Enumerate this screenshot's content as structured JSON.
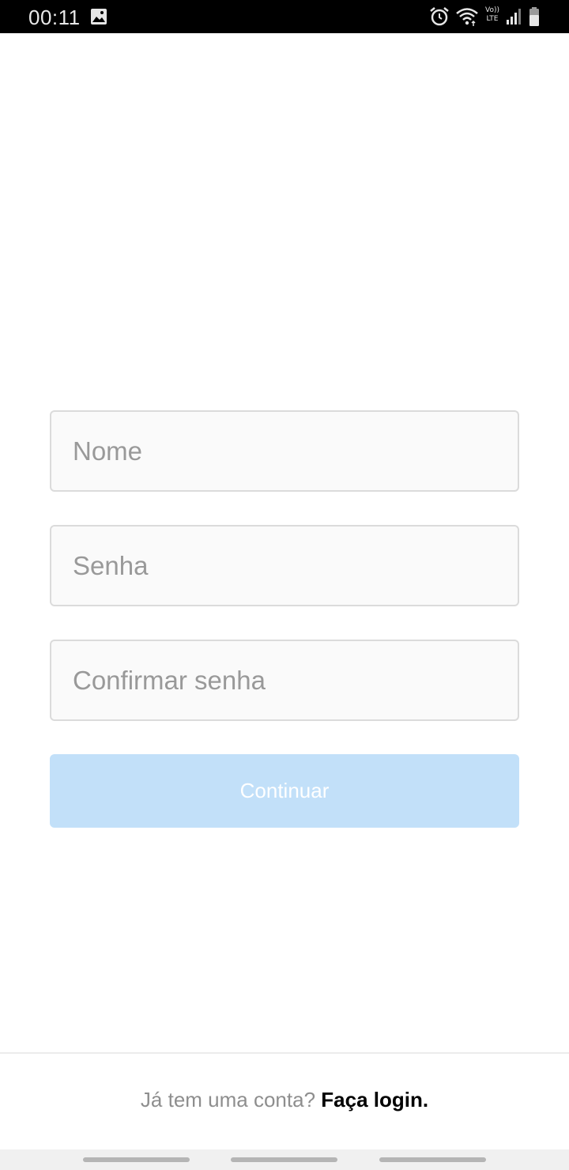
{
  "status_bar": {
    "time": "00:11",
    "volte_line1": "Vo))",
    "volte_line2": "LTE",
    "icons": [
      "gallery-icon",
      "alarm-icon",
      "wifi-icon",
      "volte-icon",
      "signal-icon",
      "battery-icon"
    ]
  },
  "form": {
    "name_placeholder": "Nome",
    "password_placeholder": "Senha",
    "confirm_placeholder": "Confirmar senha",
    "continue_label": "Continuar",
    "continue_color": "#c2e0f9"
  },
  "footer": {
    "prompt": "Já tem uma conta? ",
    "login_link": "Faça login."
  }
}
